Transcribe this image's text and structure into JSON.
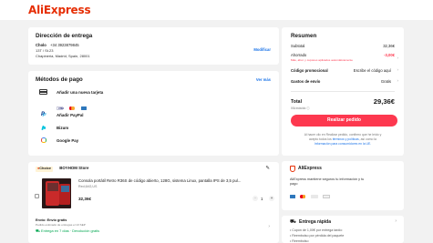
{
  "brand": {
    "logo_text": "AliExpress",
    "accent": "#e62e04",
    "button_color": "#fd384f",
    "link_color": "#1a73e8"
  },
  "shipping": {
    "title": "Dirección de entrega",
    "name": "Cholo",
    "phone": "+34 3923879845",
    "address_line1": "13T / St.23",
    "address_line2": "Chapineria, Madrid, Spain, 28001",
    "modify_label": "Modificar"
  },
  "payment": {
    "title": "Métodos de pago",
    "more_label": "Ver más",
    "methods": [
      {
        "label": "Añadir una nueva tarjeta",
        "icon": "credit-card-icon"
      },
      {
        "label": "Añadir PayPal",
        "icon": "paypal-icon"
      },
      {
        "label": "Bizum",
        "icon": "bizum-icon"
      },
      {
        "label": "Google Pay",
        "icon": "google-pay-icon"
      }
    ],
    "card_brands": [
      "visa-icon",
      "mastercard-icon",
      "amex-icon"
    ]
  },
  "store": {
    "badge": "Choice",
    "name": "BOYHOM Store",
    "product_title": "Consola portátil Retro R36S de código abierto, 128G, sistema Linux, pantalla IPS de 3,5 pul...",
    "variant": "Red,64G,US",
    "price": "32,36€",
    "quantity": "1",
    "shipping_cost_label": "Envío: Envío gratis",
    "shipping_note": "Pedido estimado de entregas el 13 SEP",
    "delivery_label": "Entrega en 7 días · Devolución gratis"
  },
  "summary": {
    "title": "Resumen",
    "subtotal_label": "Subtotal",
    "subtotal_value": "32,36€",
    "saved_label": "Ahorrado",
    "saved_value": "-3,00€",
    "saved_note": "Más, ahor. y cupones aplicados automáticamente",
    "promo_label": "Código promocional",
    "promo_placeholder": "Escribe el código aquí",
    "shipping_label": "Gastos de envío",
    "shipping_value": "Gratis",
    "total_label": "Total",
    "total_value": "29,36€",
    "tax_note": "IVA incluido",
    "order_button": "Realizar pedido",
    "legal_text_1": "Al hacer clic en Realizar pedido, confirmo que he leído y",
    "legal_text_2": "acepto todos los",
    "legal_link_1": "términos y políticas",
    "legal_text_3": ", así como la",
    "legal_link_2": "Información para consumidores en la UE."
  },
  "security": {
    "title": "AliExpress",
    "text_1": "AliExpress mantiene seguros tu información y tu",
    "text_2": "pago"
  },
  "fast_delivery": {
    "title": "Entrega rápida",
    "line_1": "Cupón de 1,00€ por entrega tardío",
    "line_2": "Reembolso por pérdida del paquete",
    "line_3": "Reembolso"
  }
}
